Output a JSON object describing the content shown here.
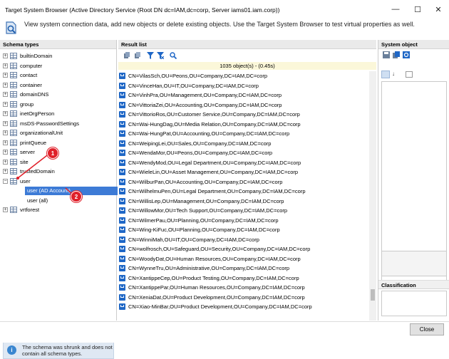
{
  "window": {
    "title": "Target System Browser (Active Directory Service (Root DN dc=IAM,dc=corp, Server iams01.iam.corp))",
    "minimize": "—",
    "maximize": "☐",
    "close": "✕"
  },
  "header": {
    "description": "View system connection data, add new objects or delete existing objects. Use the Target System Browser to test virtual properties as well."
  },
  "left_panel": {
    "title": "Schema types",
    "items": [
      {
        "label": "builtinDomain"
      },
      {
        "label": "computer"
      },
      {
        "label": "contact"
      },
      {
        "label": "container"
      },
      {
        "label": "domainDNS"
      },
      {
        "label": "group"
      },
      {
        "label": "inetOrgPerson"
      },
      {
        "label": "msDS-PasswordSettings"
      },
      {
        "label": "organizationalUnit"
      },
      {
        "label": "printQueue"
      },
      {
        "label": "server"
      },
      {
        "label": "site"
      },
      {
        "label": "trustedDomain"
      },
      {
        "label": "user"
      }
    ],
    "user_children": [
      {
        "label": "user (AD Account)",
        "selected": true
      },
      {
        "label": "user (all)",
        "selected": false
      }
    ],
    "last_item": {
      "label": "vrtforest"
    },
    "note": "The schema was shrunk and does not contain all schema types."
  },
  "callouts": [
    "1",
    "2"
  ],
  "result_panel": {
    "title": "Result list",
    "count": "1035 object(s) - (0.45s)",
    "rows": [
      "CN=VilasSch,OU=Peons,OU=Company,DC=IAM,DC=corp",
      "CN=VinceHan,OU=IT,OU=Company,DC=IAM,DC=corp",
      "CN=VinhPra,OU=Management,OU=Company,DC=IAM,DC=corp",
      "CN=VittoriaZei,OU=Accounting,OU=Company,DC=IAM,DC=corp",
      "CN=VittorioRos,OU=Customer Service,OU=Company,DC=IAM,DC=corp",
      "CN=Wai-HungDag,OU=Media Relation,OU=Company,DC=IAM,DC=corp",
      "CN=Wai-HungPat,OU=Accounting,OU=Company,DC=IAM,DC=corp",
      "CN=WeipingLei,OU=Sales,OU=Company,DC=IAM,DC=corp",
      "CN=WendaMor,OU=Peons,OU=Company,DC=IAM,DC=corp",
      "CN=WendyMod,OU=Legal Department,OU=Company,DC=IAM,DC=corp",
      "CN=WieleLin,OU=Asset Management,OU=Company,DC=IAM,DC=corp",
      "CN=WilburPan,OU=Accounting,OU=Company,DC=IAM,DC=corp",
      "CN=WilhelmuPen,OU=Legal Department,OU=Company,DC=IAM,DC=corp",
      "CN=WillisLep,OU=Management,OU=Company,DC=IAM,DC=corp",
      "CN=WillowMor,OU=Tech Support,OU=Company,DC=IAM,DC=corp",
      "CN=WilmerPau,OU=Planning,OU=Company,DC=IAM,DC=corp",
      "CN=Wing-KiFuc,OU=Planning,OU=Company,DC=IAM,DC=corp",
      "CN=WinniMah,OU=IT,OU=Company,DC=IAM,DC=corp",
      "CN=wolfrosch,OU=Safeguard,OU=Security,OU=Company,DC=IAM,DC=corp",
      "CN=WoodyDat,OU=Human Resources,OU=Company,DC=IAM,DC=corp",
      "CN=WynneTru,OU=Administrative,OU=Company,DC=IAM,DC=corp",
      "CN=XantippeCep,OU=Product Testing,OU=Company,DC=IAM,DC=corp",
      "CN=XantippePar,OU=Human Resources,OU=Company,DC=IAM,DC=corp",
      "CN=XeniaDat,OU=Product Development,OU=Company,DC=IAM,DC=corp",
      "CN=Xiao-MinBar,OU=Product Development,OU=Company,DC=IAM,DC=corp"
    ]
  },
  "right_panel": {
    "title": "System object",
    "classification_title": "Classification"
  },
  "footer": {
    "close_label": "Close"
  },
  "colors": {
    "selection": "#3d7bd6",
    "callout": "#e0202a",
    "row_icon": "#1f67c6",
    "count_bar": "#fbf7d9"
  }
}
